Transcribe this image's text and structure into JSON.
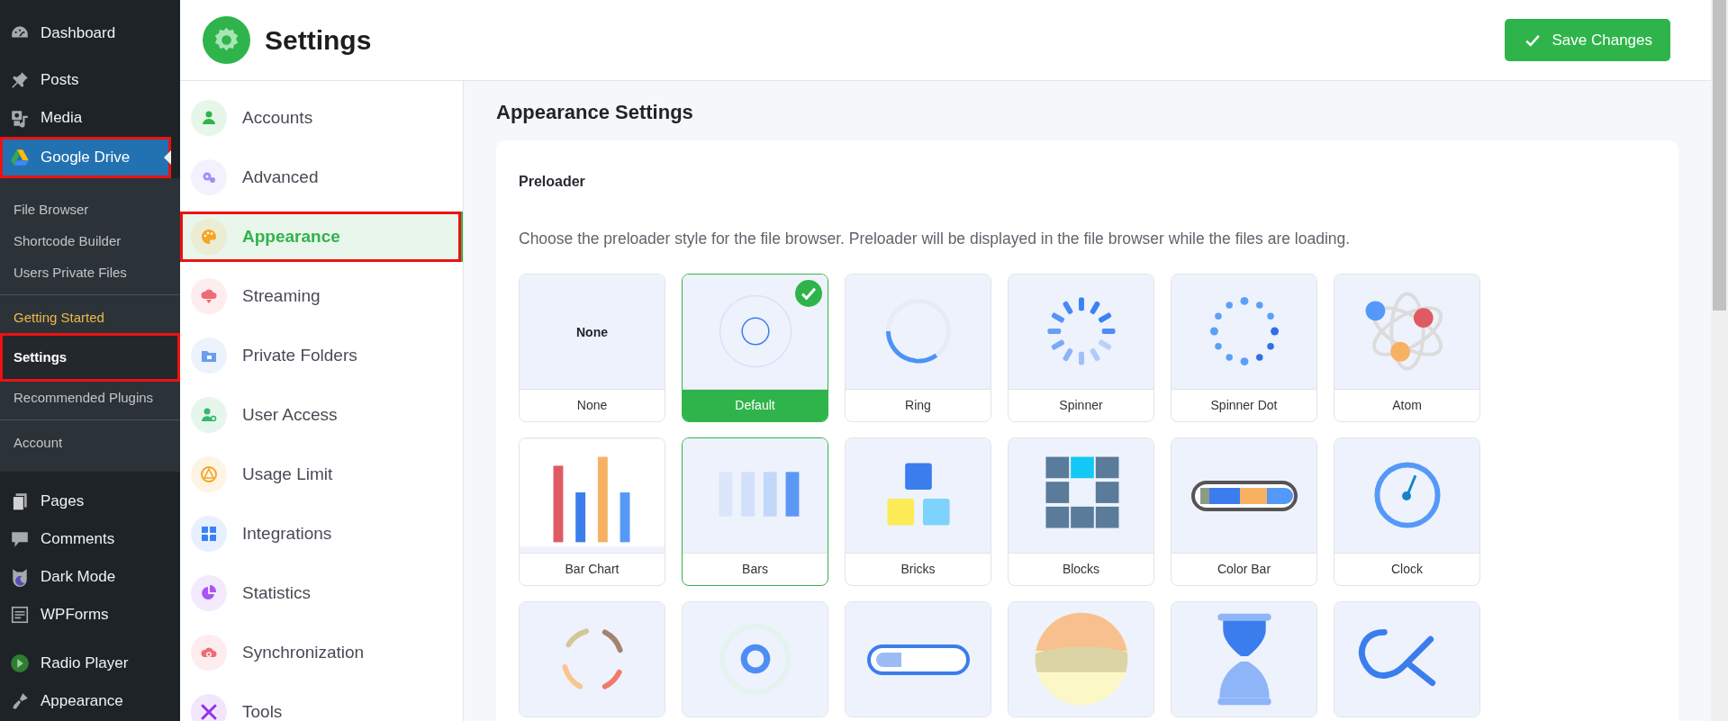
{
  "wp_menu": {
    "top": [
      {
        "label": "Dashboard"
      },
      {
        "label": "Posts"
      },
      {
        "label": "Media"
      }
    ],
    "current": {
      "label": "Google Drive",
      "selected": true,
      "annotated": true,
      "submenu_groups": [
        {
          "items": [
            {
              "label": "File Browser",
              "selected": false,
              "kind": "link",
              "annotated": false
            },
            {
              "label": "Shortcode Builder",
              "selected": false,
              "kind": "link",
              "annotated": false
            },
            {
              "label": "Users Private Files",
              "selected": false,
              "kind": "link",
              "annotated": false
            }
          ]
        },
        {
          "items": [
            {
              "label": "Getting Started",
              "selected": false,
              "kind": "promo",
              "annotated": false
            },
            {
              "label": "Settings",
              "selected": true,
              "kind": "link",
              "annotated": true
            },
            {
              "label": "Recommended Plugins",
              "selected": false,
              "kind": "link",
              "annotated": false
            }
          ]
        },
        {
          "items": [
            {
              "label": "Account",
              "selected": false,
              "kind": "link",
              "annotated": false
            }
          ]
        }
      ]
    },
    "bottom": [
      {
        "label": "Pages"
      },
      {
        "label": "Comments"
      },
      {
        "label": "Dark Mode"
      },
      {
        "label": "WPForms"
      },
      {
        "label": "Radio Player"
      },
      {
        "label": "Appearance"
      }
    ]
  },
  "header": {
    "title": "Settings",
    "save_button": "Save Changes"
  },
  "settings_nav": [
    {
      "label": "Accounts",
      "selected": false,
      "annotated": false,
      "color": "#2fb44b"
    },
    {
      "label": "Advanced",
      "selected": false,
      "annotated": false,
      "color": "#a78bfa"
    },
    {
      "label": "Appearance",
      "selected": true,
      "annotated": true,
      "color": "#f5a524"
    },
    {
      "label": "Streaming",
      "selected": false,
      "annotated": false,
      "color": "#ef6b73"
    },
    {
      "label": "Private Folders",
      "selected": false,
      "annotated": false,
      "color": "#6b9cf0"
    },
    {
      "label": "User Access",
      "selected": false,
      "annotated": false,
      "color": "#34b86b"
    },
    {
      "label": "Usage Limit",
      "selected": false,
      "annotated": false,
      "color": "#f5a524"
    },
    {
      "label": "Integrations",
      "selected": false,
      "annotated": false,
      "color": "#3b82f6"
    },
    {
      "label": "Statistics",
      "selected": false,
      "annotated": false,
      "color": "#a855f7"
    },
    {
      "label": "Synchronization",
      "selected": false,
      "annotated": false,
      "color": "#ef6b73"
    },
    {
      "label": "Tools",
      "selected": false,
      "annotated": false,
      "color": "#9333ea"
    }
  ],
  "main": {
    "title": "Appearance Settings",
    "section_title": "Preloader",
    "description": "Choose the preloader style for the file browser. Preloader will be displayed in the file browser while the files are loading.",
    "tiles": [
      {
        "kind": "none",
        "preview_text": "None",
        "label": "None",
        "selected": false,
        "hovered": false
      },
      {
        "kind": "default",
        "label": "Default",
        "selected": true,
        "hovered": false
      },
      {
        "kind": "ring",
        "label": "Ring",
        "selected": false,
        "hovered": false
      },
      {
        "kind": "spinner",
        "label": "Spinner",
        "selected": false,
        "hovered": false
      },
      {
        "kind": "spinner-dot",
        "label": "Spinner Dot",
        "selected": false,
        "hovered": false
      },
      {
        "kind": "atom",
        "label": "Atom",
        "selected": false,
        "hovered": false
      },
      {
        "kind": "bar-chart",
        "label": "Bar Chart",
        "selected": false,
        "hovered": false
      },
      {
        "kind": "bars",
        "label": "Bars",
        "selected": false,
        "hovered": true
      },
      {
        "kind": "bricks",
        "label": "Bricks",
        "selected": false,
        "hovered": false
      },
      {
        "kind": "blocks",
        "label": "Blocks",
        "selected": false,
        "hovered": false
      },
      {
        "kind": "color-bar",
        "label": "Color Bar",
        "selected": false,
        "hovered": false
      },
      {
        "kind": "clock",
        "label": "Clock",
        "selected": false,
        "hovered": false
      },
      {
        "kind": "dashes",
        "selected": false,
        "hovered": false
      },
      {
        "kind": "target",
        "selected": false,
        "hovered": false
      },
      {
        "kind": "pill",
        "selected": false,
        "hovered": false
      },
      {
        "kind": "sun",
        "selected": false,
        "hovered": false
      },
      {
        "kind": "hourglass",
        "selected": false,
        "hovered": false
      },
      {
        "kind": "loop",
        "selected": false,
        "hovered": false
      }
    ]
  }
}
